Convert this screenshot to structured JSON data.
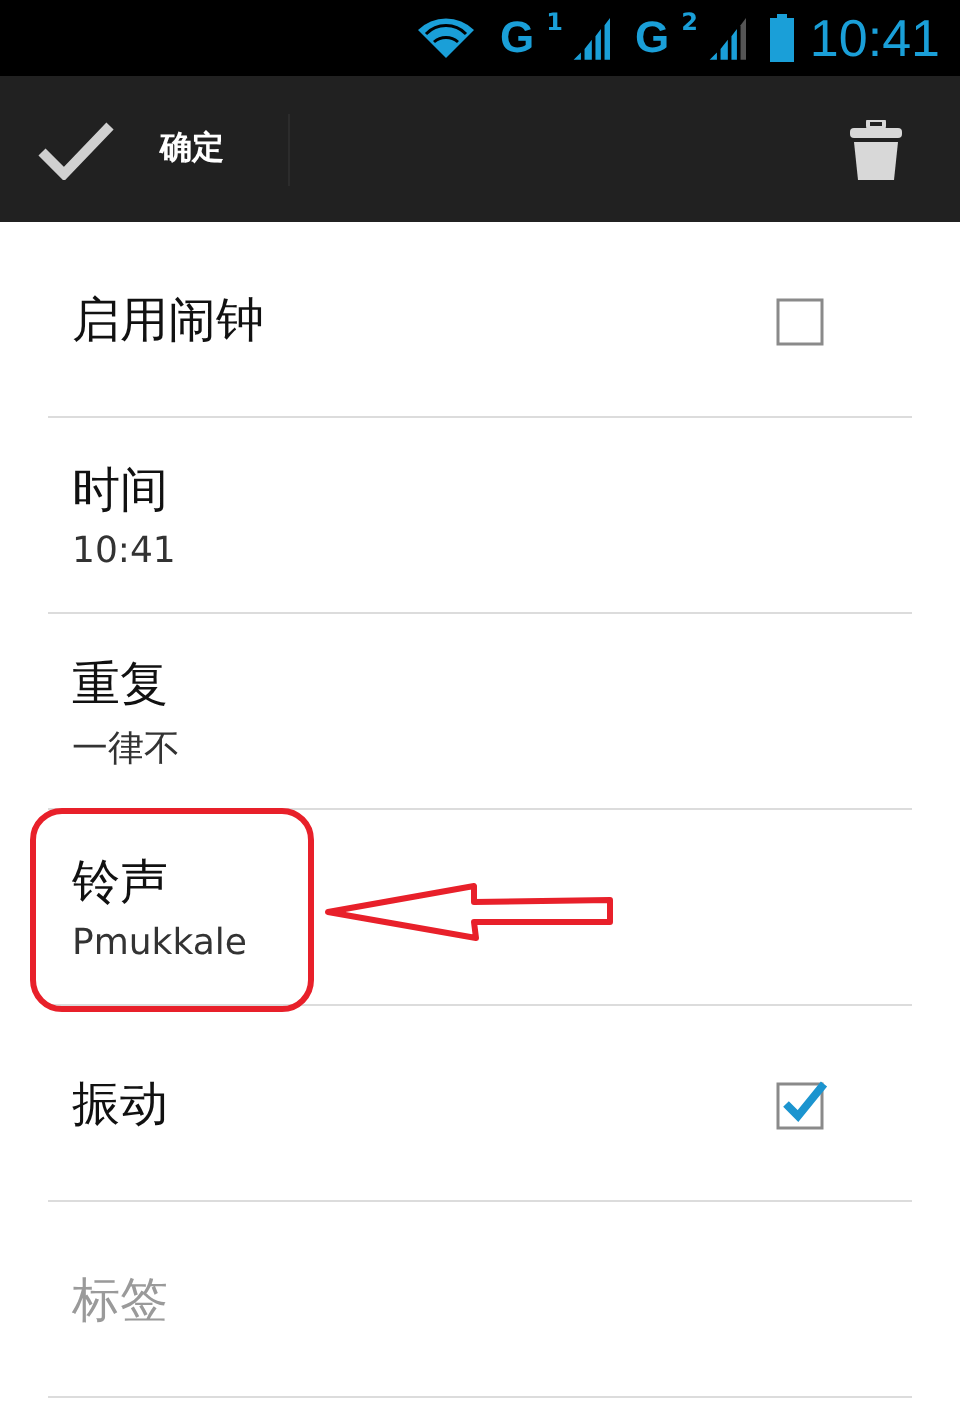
{
  "status_bar": {
    "network_1": "G",
    "sim_1": "1",
    "network_2": "G",
    "sim_2": "2",
    "time": "10:41"
  },
  "action_bar": {
    "confirm_label": "确定"
  },
  "settings": [
    {
      "kind": "checkbox",
      "title": "启用闹钟",
      "checked": false,
      "disabled": false,
      "highlighted": false
    },
    {
      "kind": "detail",
      "title": "时间",
      "summary": "10:41",
      "disabled": false,
      "highlighted": false
    },
    {
      "kind": "detail",
      "title": "重复",
      "summary": "一律不",
      "disabled": false,
      "highlighted": false
    },
    {
      "kind": "detail",
      "title": "铃声",
      "summary": "Pmukkale",
      "disabled": false,
      "highlighted": true
    },
    {
      "kind": "checkbox",
      "title": "振动",
      "checked": true,
      "disabled": false,
      "highlighted": false
    },
    {
      "kind": "plain",
      "title": "标签",
      "disabled": true,
      "highlighted": false
    }
  ]
}
